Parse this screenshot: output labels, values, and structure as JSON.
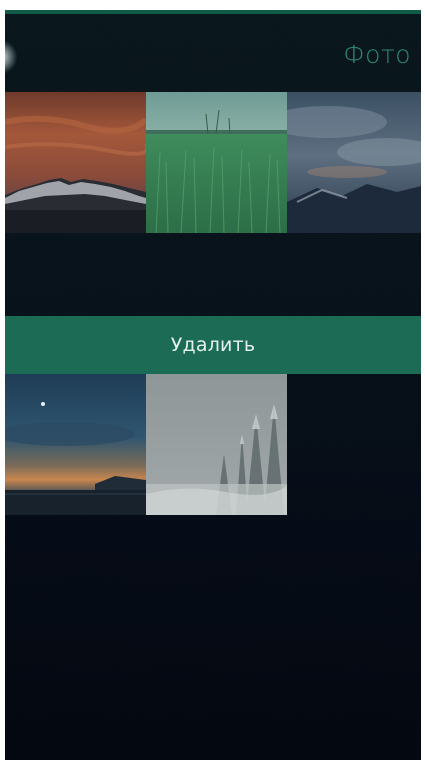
{
  "header": {
    "title": "Фото"
  },
  "remorse": {
    "label": "Удалить",
    "color": "#1b6b55"
  },
  "colors": {
    "accent": "#2f8a73",
    "top_bar": "#0f5a49",
    "background": "#050b16"
  },
  "photos": [
    {
      "name": "snowy-mountain-sunset"
    },
    {
      "name": "green-grass-field"
    },
    {
      "name": "cloudy-mountains"
    },
    {
      "name": "seashore-dusk"
    },
    {
      "name": "snowy-forest"
    }
  ]
}
